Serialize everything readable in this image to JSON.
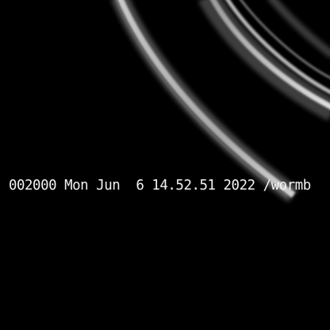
{
  "caption": {
    "text": "002000 Mon Jun  6 14.52.51 2022 /wormb"
  },
  "colors": {
    "background": "#000000",
    "caption_text": "#f2f2f2",
    "arc_highlight": "#d8d8d8",
    "arc_shadow": "#5a5a5a"
  }
}
